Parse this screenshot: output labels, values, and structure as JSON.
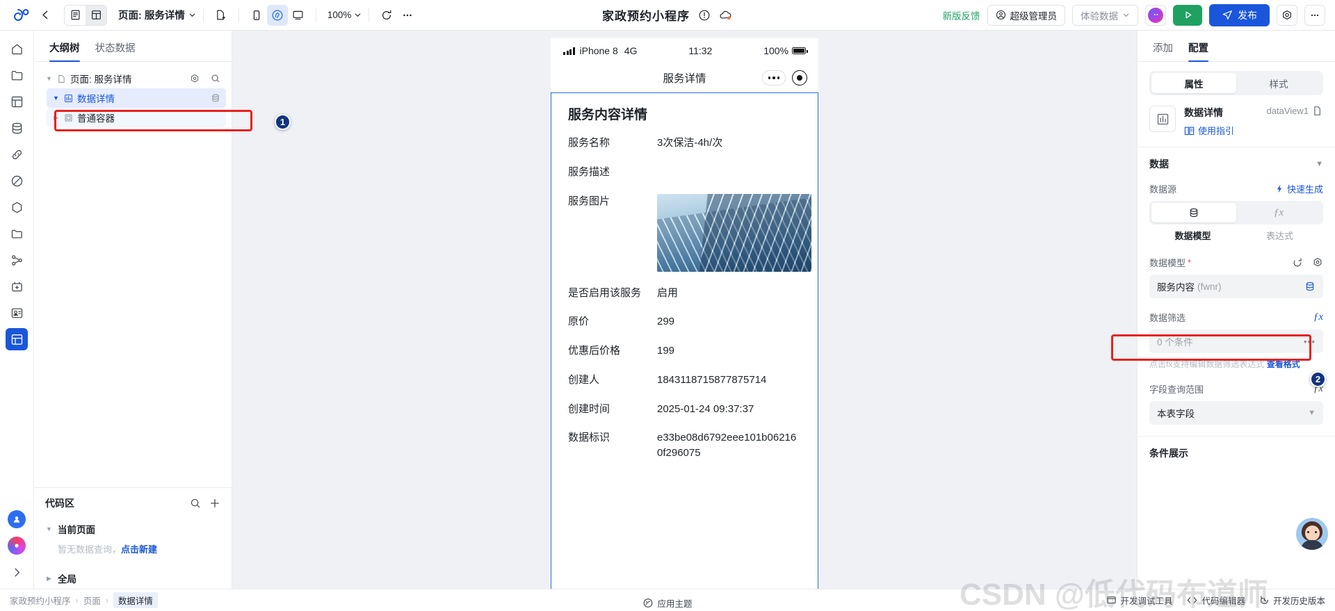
{
  "topbar": {
    "page_select_label": "页面: 服务详情",
    "zoom_level": "100%",
    "app_title": "家政预约小程序",
    "feedback_link": "新版反馈",
    "role_label": "超级管理员",
    "data_mode_label": "体验数据",
    "publish_label": "发布",
    "accent_blue": "#1a56db",
    "accent_green": "#20a162"
  },
  "outline": {
    "tabs": [
      {
        "label": "大纲树",
        "active": true
      },
      {
        "label": "状态数据",
        "active": false
      }
    ],
    "tree": [
      {
        "label": "页面: 服务详情",
        "level": 0
      },
      {
        "label": "数据详情",
        "level": 1
      },
      {
        "label": "普通容器",
        "level": 2
      }
    ],
    "code_area": {
      "title": "代码区",
      "current_page_label": "当前页面",
      "empty_text": "暂无数据查询，",
      "empty_link": "点击新建",
      "global_label": "全局"
    }
  },
  "phone": {
    "status": {
      "device": "iPhone 8",
      "network": "4G",
      "time": "11:32",
      "battery": "100%"
    },
    "nav_title": "服务详情",
    "heading": "服务内容详情",
    "fields": [
      {
        "label": "服务名称",
        "value": "3次保洁-4h/次",
        "type": "text"
      },
      {
        "label": "服务描述",
        "value": "",
        "type": "text"
      },
      {
        "label": "服务图片",
        "value": "",
        "type": "image"
      },
      {
        "label": "是否启用该服务",
        "value": "启用",
        "type": "text"
      },
      {
        "label": "原价",
        "value": "299",
        "type": "text"
      },
      {
        "label": "优惠后价格",
        "value": "199",
        "type": "text"
      },
      {
        "label": "创建人",
        "value": "1843118715877875714",
        "type": "text"
      },
      {
        "label": "创建时间",
        "value": "2025-01-24 09:37:37",
        "type": "text"
      },
      {
        "label": "数据标识",
        "value": "e33be08d6792eee101b062160f296075",
        "type": "text"
      }
    ]
  },
  "rpanel": {
    "tabs": [
      {
        "label": "添加",
        "active": false
      },
      {
        "label": "配置",
        "active": true
      }
    ],
    "segment": [
      {
        "label": "属性",
        "active": true
      },
      {
        "label": "样式",
        "active": false
      }
    ],
    "component": {
      "name": "数据详情",
      "guide_label": "使用指引",
      "id": "dataView1"
    },
    "data_section": {
      "title": "数据",
      "source_label": "数据源",
      "quick_gen_label": "快速生成",
      "source_tabs": [
        {
          "label": "数据模型",
          "active": true
        },
        {
          "label": "表达式",
          "active": false
        }
      ],
      "model_label": "数据模型",
      "model_value": "服务内容",
      "model_value_sub": "(fwnr)",
      "filter_label": "数据筛选",
      "filter_value": "0 个条件",
      "filter_hint": "点击fx支持编辑数据筛选表达式",
      "filter_hint_link": "查看格式",
      "field_scope_label": "字段查询范围",
      "field_scope_value": "本表字段",
      "condition_title": "条件展示"
    }
  },
  "annotations": [
    {
      "number": "1"
    },
    {
      "number": "2"
    }
  ],
  "bottom": {
    "breadcrumb": [
      "家政预约小程序",
      "页面",
      "数据详情"
    ],
    "debug_tool": "开发调试工具",
    "code_editor": "代码编辑器",
    "history": "开发历史版本",
    "theme": "应用主题"
  },
  "watermark": "CSDN @低代码布道师"
}
